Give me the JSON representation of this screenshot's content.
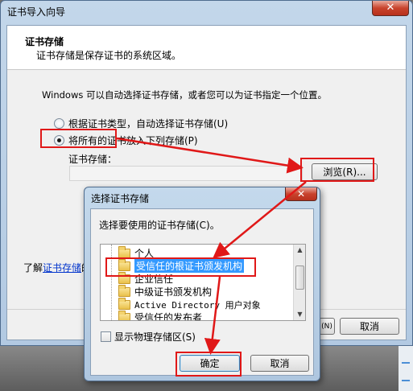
{
  "wizard": {
    "title": "证书导入向导",
    "close_glyph": "✕",
    "heading": "证书存储",
    "subheading": "证书存储是保存证书的系统区域。",
    "intro": "Windows 可以自动选择证书存储，或者您可以为证书指定一个位置。",
    "radio_auto": "根据证书类型，自动选择证书存储(U)",
    "radio_manual": "将所有的证书放入下列存储(P)",
    "store_label": "证书存储：",
    "store_value": "",
    "browse_label": "浏览(R)...",
    "learn_prefix": "了解",
    "learn_link": "证书存储",
    "learn_suffix": "的",
    "next_fragment": "(N)",
    "cancel_label": "取消"
  },
  "dialog": {
    "title": "选择证书存储",
    "close_glyph": "✕",
    "prompt": "选择要使用的证书存储(C)。",
    "stores": [
      {
        "label": "个人",
        "selected": false
      },
      {
        "label": "受信任的根证书颁发机构",
        "selected": true
      },
      {
        "label": "企业信任",
        "selected": false
      },
      {
        "label": "中级证书颁发机构",
        "selected": false
      },
      {
        "label": "Active Directory 用户对象",
        "selected": false
      },
      {
        "label": "受信任的发布者",
        "selected": false
      }
    ],
    "show_physical": "显示物理存储区(S)",
    "ok_label": "确定",
    "cancel_label": "取消"
  },
  "colors": {
    "highlight": "#e01818",
    "selection": "#3399ff"
  }
}
